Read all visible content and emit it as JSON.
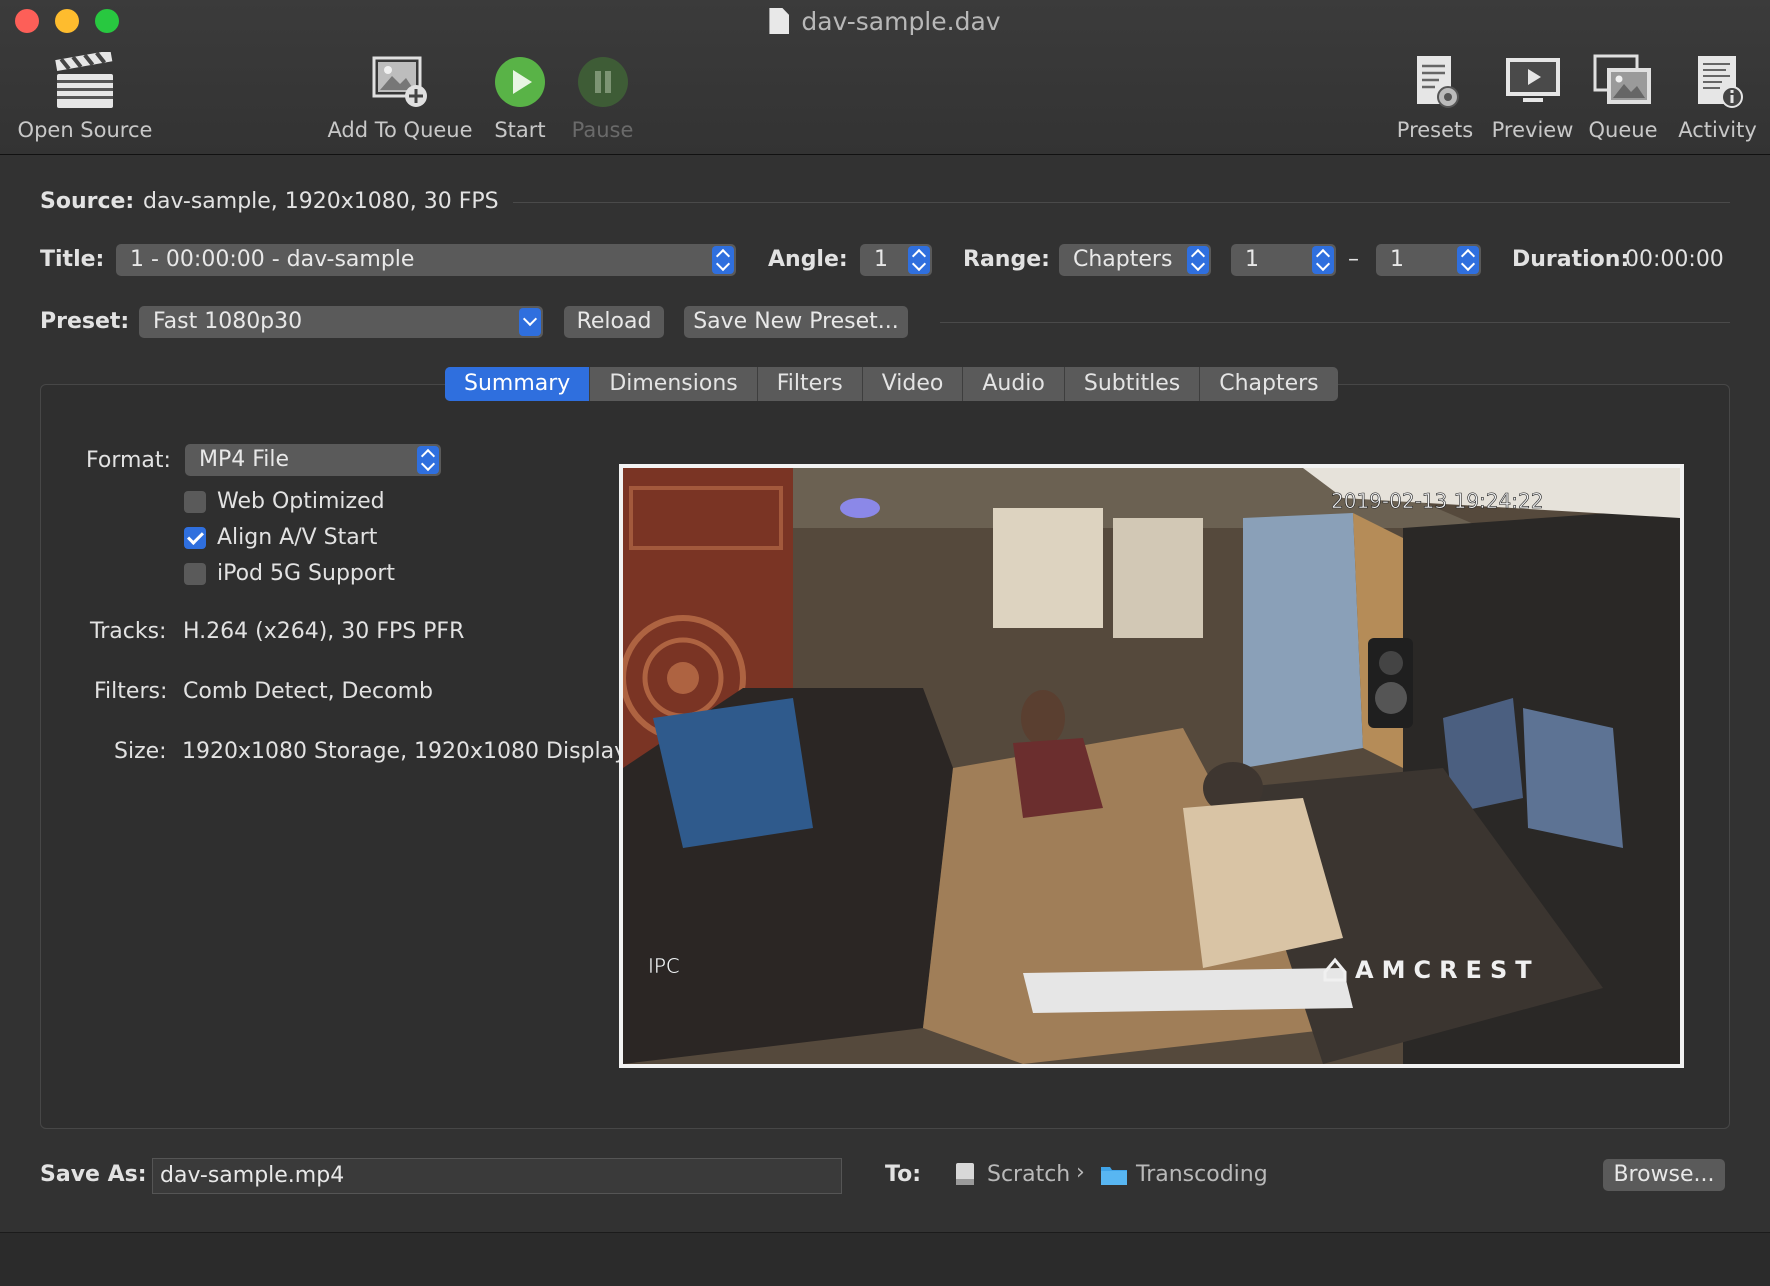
{
  "window": {
    "title": "dav-sample.dav"
  },
  "toolbar": {
    "open_source": "Open Source",
    "add_to_queue": "Add To Queue",
    "start": "Start",
    "pause": "Pause",
    "presets": "Presets",
    "preview": "Preview",
    "queue": "Queue",
    "activity": "Activity"
  },
  "source": {
    "label": "Source:",
    "value": "dav-sample, 1920x1080, 30 FPS"
  },
  "title_row": {
    "title_label": "Title:",
    "title_value": "1 - 00:00:00 - dav-sample",
    "angle_label": "Angle:",
    "angle_value": "1",
    "range_label": "Range:",
    "range_type": "Chapters",
    "range_start": "1",
    "range_dash": "–",
    "range_end": "1",
    "duration_label": "Duration:",
    "duration_value": "00:00:00"
  },
  "preset_row": {
    "label": "Preset:",
    "value": "Fast 1080p30",
    "reload": "Reload",
    "save_new": "Save New Preset..."
  },
  "tabs": [
    {
      "label": "Summary",
      "active": true
    },
    {
      "label": "Dimensions",
      "active": false
    },
    {
      "label": "Filters",
      "active": false
    },
    {
      "label": "Video",
      "active": false
    },
    {
      "label": "Audio",
      "active": false
    },
    {
      "label": "Subtitles",
      "active": false
    },
    {
      "label": "Chapters",
      "active": false
    }
  ],
  "summary": {
    "format_label": "Format:",
    "format_value": "MP4 File",
    "options": [
      {
        "label": "Web Optimized",
        "checked": false
      },
      {
        "label": "Align A/V Start",
        "checked": true
      },
      {
        "label": "iPod 5G Support",
        "checked": false
      }
    ],
    "tracks_label": "Tracks:",
    "tracks_value": "H.264 (x264), 30 FPS PFR",
    "filters_label": "Filters:",
    "filters_value": "Comb Detect, Decomb",
    "size_label": "Size:",
    "size_value": "1920x1080 Storage, 1920x1080 Display"
  },
  "preview": {
    "timestamp": "2019-02-13 19:24:22",
    "corner_label": "IPC",
    "brand": "AMCREST"
  },
  "save": {
    "label": "Save As:",
    "filename": "dav-sample.mp4",
    "to_label": "To:",
    "drive": "Scratch",
    "folder": "Transcoding",
    "browse": "Browse..."
  }
}
